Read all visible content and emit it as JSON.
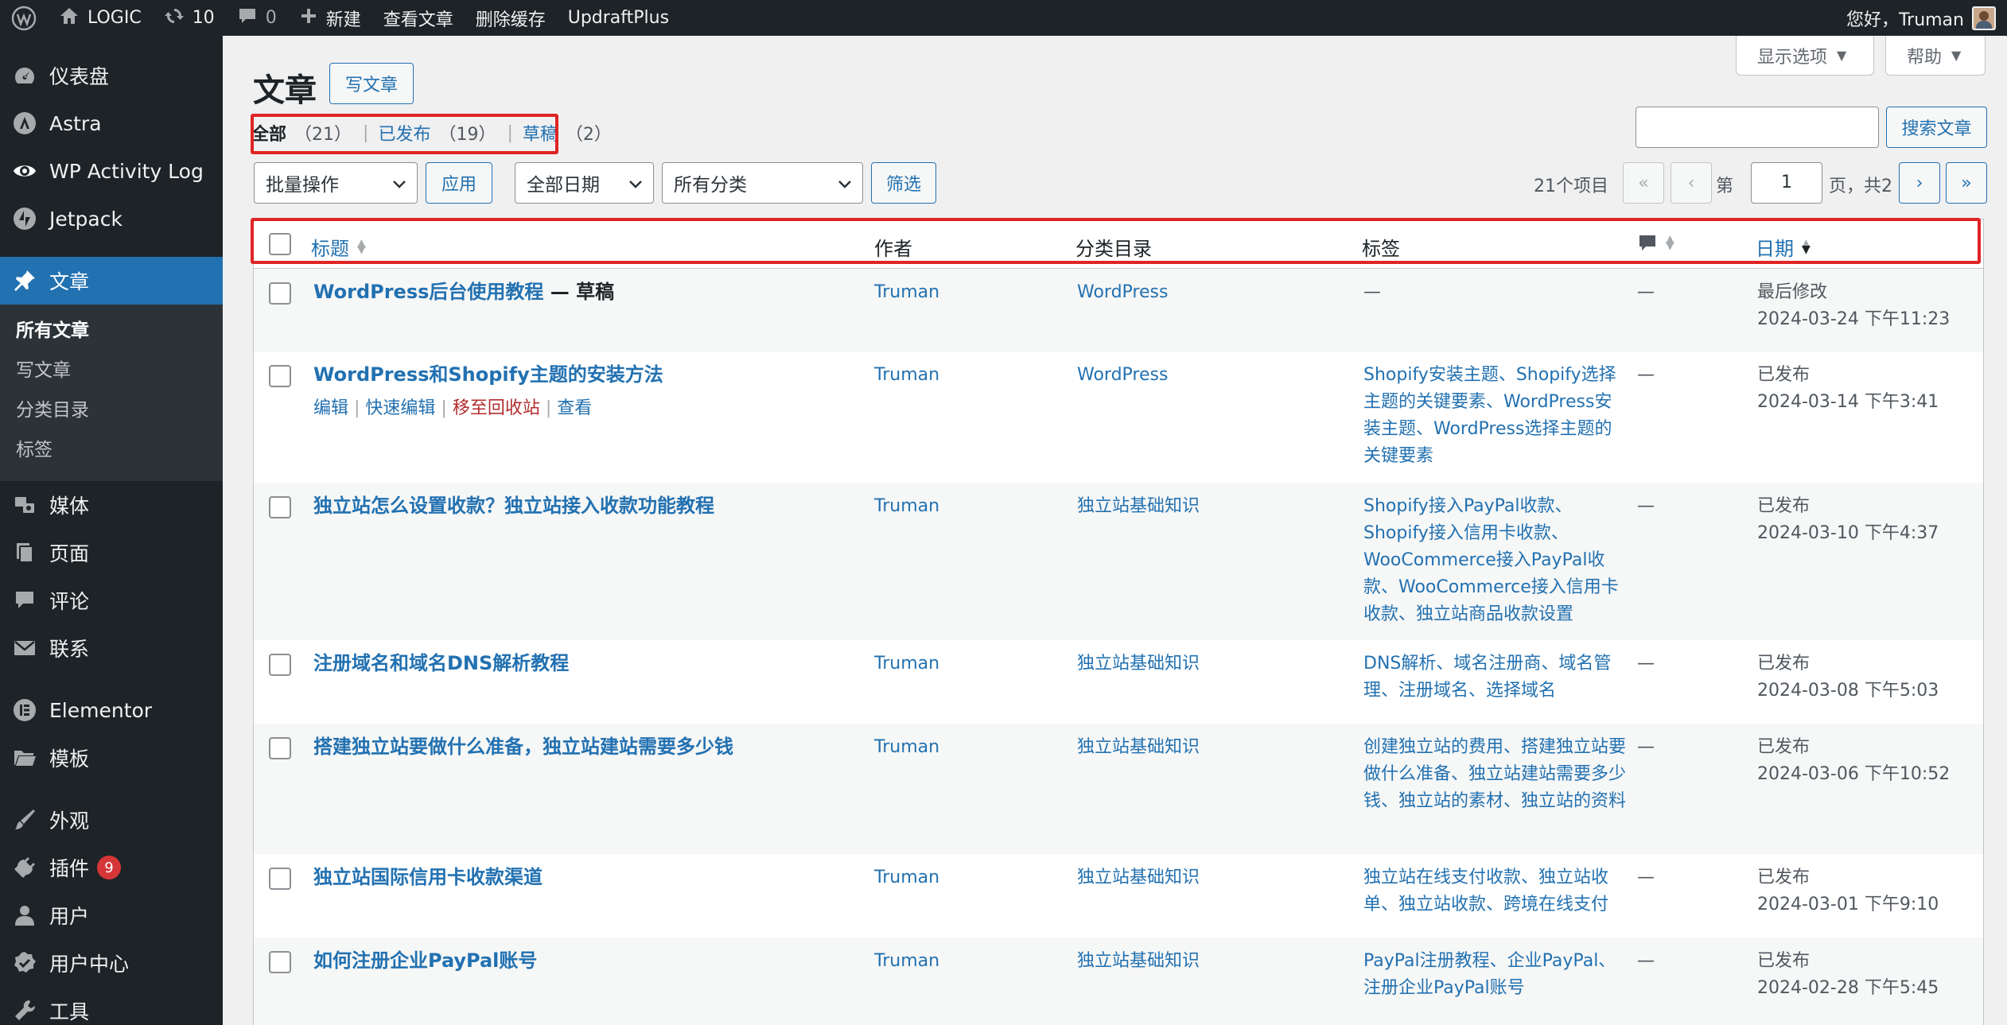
{
  "adminbar": {
    "site_name": "LOGIC",
    "updates_count": "10",
    "comments_count": "0",
    "new_label": "新建",
    "view_posts": "查看文章",
    "clear_cache": "删除缓存",
    "updraft": "UpdraftPlus",
    "greeting": "您好，Truman"
  },
  "sidebar": {
    "dashboard": "仪表盘",
    "astra": "Astra",
    "activity_log": "WP Activity Log",
    "jetpack": "Jetpack",
    "posts": "文章",
    "submenu": [
      "所有文章",
      "写文章",
      "分类目录",
      "标签"
    ],
    "media": "媒体",
    "pages": "页面",
    "comments": "评论",
    "contact": "联系",
    "elementor": "Elementor",
    "templates": "模板",
    "appearance": "外观",
    "plugins": "插件",
    "plugins_badge": "9",
    "users": "用户",
    "user_center": "用户中心",
    "tools": "工具"
  },
  "screen_meta": {
    "options": "显示选项",
    "help": "帮助"
  },
  "page": {
    "title": "文章",
    "add_new": "写文章",
    "filters": [
      {
        "label": "全部",
        "count": "（21）"
      },
      {
        "label": "已发布",
        "count": "（19）"
      },
      {
        "label": "草稿",
        "count": "（2）"
      }
    ],
    "search_button": "搜索文章",
    "bulk_action": "批量操作",
    "apply": "应用",
    "all_dates": "全部日期",
    "all_categories": "所有分类",
    "filter": "筛选",
    "items_count": "21个项目",
    "first_page": "«",
    "prev_page": "‹",
    "next_page": "›",
    "last_page": "»",
    "page_prefix": "第",
    "current_page": "1",
    "page_suffix": "页，共2 页"
  },
  "table": {
    "columns": {
      "title": "标题",
      "author": "作者",
      "categories": "分类目录",
      "tags": "标签",
      "date": "日期"
    },
    "row_actions": {
      "edit": "编辑",
      "quick_edit": "快速编辑",
      "trash": "移至回收站",
      "view": "查看"
    },
    "rows": [
      {
        "title": "WordPress后台使用教程",
        "state": " — 草稿",
        "author": "Truman",
        "category": "WordPress",
        "tags": "—",
        "comments": "—",
        "date_status": "最后修改",
        "date": "2024-03-24 下午11:23"
      },
      {
        "title": "WordPress和Shopify主题的安装方法",
        "state": "",
        "author": "Truman",
        "category": "WordPress",
        "tags": "Shopify安装主题、Shopify选择主题的关键要素、WordPress安装主题、WordPress选择主题的关键要素",
        "comments": "—",
        "date_status": "已发布",
        "date": "2024-03-14 下午3:41"
      },
      {
        "title": "独立站怎么设置收款？独立站接入收款功能教程",
        "state": "",
        "author": "Truman",
        "category": "独立站基础知识",
        "tags": "Shopify接入PayPal收款、Shopify接入信用卡收款、WooCommerce接入PayPal收款、WooCommerce接入信用卡收款、独立站商品收款设置",
        "comments": "—",
        "date_status": "已发布",
        "date": "2024-03-10 下午4:37"
      },
      {
        "title": "注册域名和域名DNS解析教程",
        "state": "",
        "author": "Truman",
        "category": "独立站基础知识",
        "tags": "DNS解析、域名注册商、域名管理、注册域名、选择域名",
        "comments": "—",
        "date_status": "已发布",
        "date": "2024-03-08 下午5:03"
      },
      {
        "title": "搭建独立站要做什么准备，独立站建站需要多少钱",
        "state": "",
        "author": "Truman",
        "category": "独立站基础知识",
        "tags": "创建独立站的费用、搭建独立站要做什么准备、独立站建站需要多少钱、独立站的素材、独立站的资料",
        "comments": "—",
        "date_status": "已发布",
        "date": "2024-03-06 下午10:52"
      },
      {
        "title": "独立站国际信用卡收款渠道",
        "state": "",
        "author": "Truman",
        "category": "独立站基础知识",
        "tags": "独立站在线支付收款、独立站收单、独立站收款、跨境在线支付",
        "comments": "—",
        "date_status": "已发布",
        "date": "2024-03-01 下午9:10"
      },
      {
        "title": "如何注册企业PayPal账号",
        "state": "",
        "author": "Truman",
        "category": "独立站基础知识",
        "tags": "PayPal注册教程、企业PayPal、注册企业PayPal账号",
        "comments": "—",
        "date_status": "已发布",
        "date": "2024-02-28 下午5:45"
      }
    ]
  }
}
